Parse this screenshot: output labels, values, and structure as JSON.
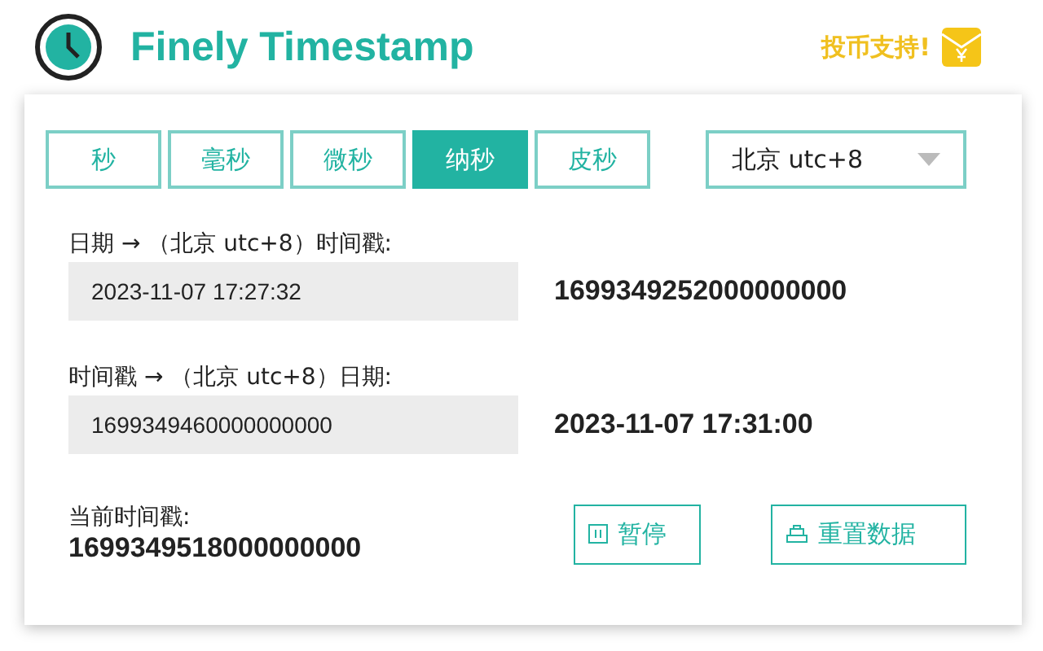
{
  "header": {
    "title": "Finely Timestamp",
    "support": "投币支持!"
  },
  "units": [
    {
      "label": "秒",
      "selected": false
    },
    {
      "label": "毫秒",
      "selected": false
    },
    {
      "label": "微秒",
      "selected": false
    },
    {
      "label": "纳秒",
      "selected": true
    },
    {
      "label": "皮秒",
      "selected": false
    }
  ],
  "timezone": {
    "value": "北京 utc+8"
  },
  "date_to_timestamp": {
    "label": "日期 → （北京 utc+8）时间戳:",
    "value": "2023-11-07 17:27:32",
    "result": "1699349252000000000"
  },
  "timestamp_to_date": {
    "label": "时间戳 → （北京 utc+8）日期:",
    "value": "1699349460000000000",
    "result": "2023-11-07 17:31:00"
  },
  "current": {
    "label": "当前时间戳:",
    "value": "1699349518000000000"
  },
  "buttons": [
    {
      "kind": "pause",
      "label": "暂停"
    },
    {
      "kind": "reset",
      "label": "重置数据"
    }
  ]
}
